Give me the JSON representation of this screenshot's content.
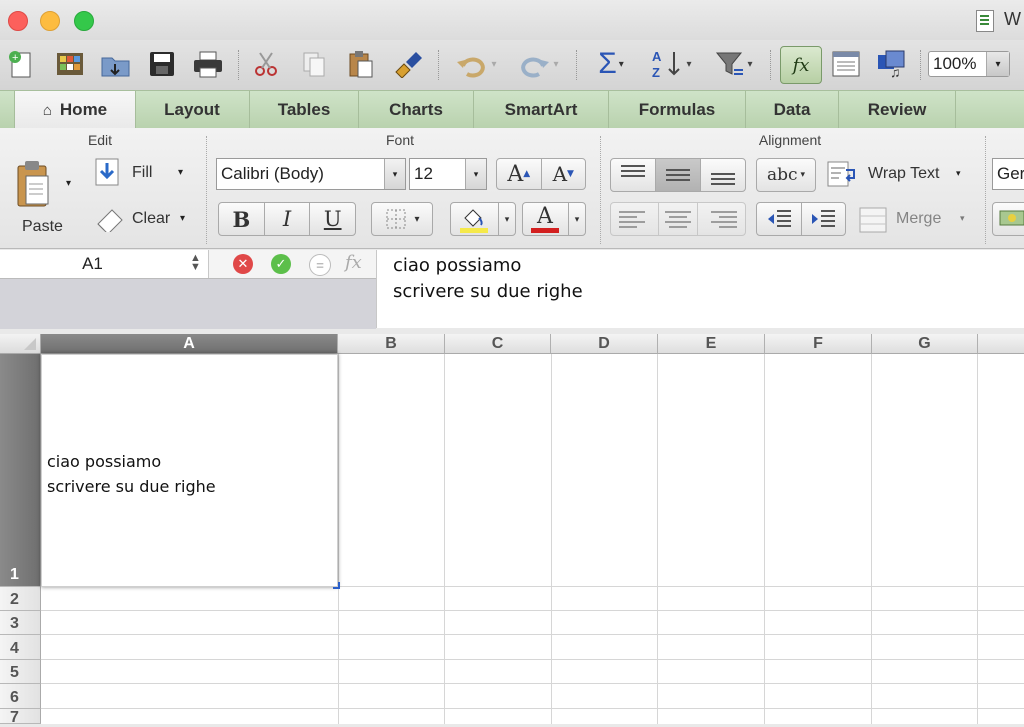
{
  "window": {
    "title_partial": "W"
  },
  "toolbar": {
    "zoom": "100%"
  },
  "tabs": [
    "Home",
    "Layout",
    "Tables",
    "Charts",
    "SmartArt",
    "Formulas",
    "Data",
    "Review"
  ],
  "ribbon": {
    "edit": {
      "title": "Edit",
      "paste": "Paste",
      "fill": "Fill",
      "clear": "Clear"
    },
    "font": {
      "title": "Font",
      "family": "Calibri (Body)",
      "size": "12",
      "bold": "B",
      "italic": "I",
      "underline": "U",
      "grow": "A",
      "shrink": "A",
      "color_letter": "A",
      "highlight_color": "#f5e94a",
      "text_color": "#d32020"
    },
    "alignment": {
      "title": "Alignment",
      "orientation": "abc",
      "wrap_text": "Wrap Text",
      "merge": "Merge"
    },
    "number": {
      "format_partial": "Ger"
    }
  },
  "formula_bar": {
    "name_box": "A1",
    "fx": "fx",
    "content": "ciao possiamo\nscrivere su due righe"
  },
  "sheet": {
    "columns": [
      "A",
      "B",
      "C",
      "D",
      "E",
      "F",
      "G"
    ],
    "rows": [
      "1",
      "2",
      "3",
      "4",
      "5",
      "6",
      "7"
    ],
    "selected_cell": "A1",
    "cells": {
      "A1": "ciao possiamo\nscrivere su due righe"
    }
  }
}
